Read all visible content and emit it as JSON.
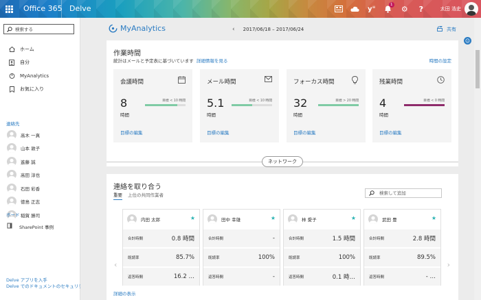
{
  "topbar": {
    "brand": "Office 365",
    "app": "Delve",
    "notification_count": "1",
    "user_name": "太田 浩史"
  },
  "sidebar": {
    "search_placeholder": "検索する",
    "nav": [
      {
        "label": "ホーム",
        "icon": "home-icon"
      },
      {
        "label": "自分",
        "icon": "profile-icon"
      },
      {
        "label": "MyAnalytics",
        "icon": "analytics-icon"
      },
      {
        "label": "お気に入り",
        "icon": "bookmark-icon"
      }
    ],
    "contacts_heading": "連絡先",
    "contacts": [
      "高木 一真",
      "山本 敦子",
      "進藤 誠",
      "高田 淳也",
      "石田 彩香",
      "徳島 正志",
      "稲賀 勝司"
    ],
    "boards_heading": "ボード",
    "board": "SharePoint 事例",
    "footer_line1": "Delve アプリを入手",
    "footer_line2": "Delve でのドキュメントのセキュリティにつ"
  },
  "header": {
    "logo_text": "MyAnalytics",
    "date_range": "2017/06/18 – 2017/06/24",
    "share_label": "共有"
  },
  "work": {
    "title": "作業時間",
    "subtitle": "統計はメールと予定表に基づいています",
    "details_link": "詳細情報を見る",
    "settings_link": "時間の設定",
    "metrics": [
      {
        "title": "会議時間",
        "value": "8",
        "unit": "時間",
        "goal": "目標 < 10 時間",
        "progress": 0.8,
        "color": "#7fcba4",
        "edit": "目標の編集",
        "icon": "calendar-icon"
      },
      {
        "title": "メール時間",
        "value": "5.1",
        "unit": "時間",
        "goal": "目標 < 10 時間",
        "progress": 0.51,
        "color": "#7fcba4",
        "edit": "目標の編集",
        "icon": "mail-icon"
      },
      {
        "title": "フォーカス時間",
        "value": "32",
        "unit": "時間",
        "goal": "目標 > 20 時間",
        "progress": 1.0,
        "color": "#7fcba4",
        "edit": "目標の編集",
        "icon": "lightbulb-icon"
      },
      {
        "title": "残業時間",
        "value": "4",
        "unit": "時間",
        "goal": "目標 < 0 時間",
        "progress": 1.0,
        "color": "#8e2b6b",
        "edit": "目標の編集",
        "icon": "clock-icon"
      }
    ]
  },
  "network_label": "ネットワーク",
  "connect": {
    "title": "連絡を取り合う",
    "tabs": [
      "重要",
      "上位の共同作業者"
    ],
    "search_placeholder": "検索して追加",
    "more_link": "詳細の表示",
    "row_labels": [
      "合計時間",
      "既読率",
      "返答時間"
    ],
    "people": [
      {
        "name": "内田 太郎",
        "values": [
          "0.8 時間",
          "85.7%",
          "16.2 …"
        ]
      },
      {
        "name": "田中 幸雄",
        "values": [
          "-",
          "100%",
          "-"
        ]
      },
      {
        "name": "林 愛子",
        "values": [
          "1.5 時間",
          "100%",
          "0.1 時…"
        ]
      },
      {
        "name": "武田 豊",
        "values": [
          "2.8 時間",
          "89.5%",
          "- …"
        ]
      }
    ]
  }
}
